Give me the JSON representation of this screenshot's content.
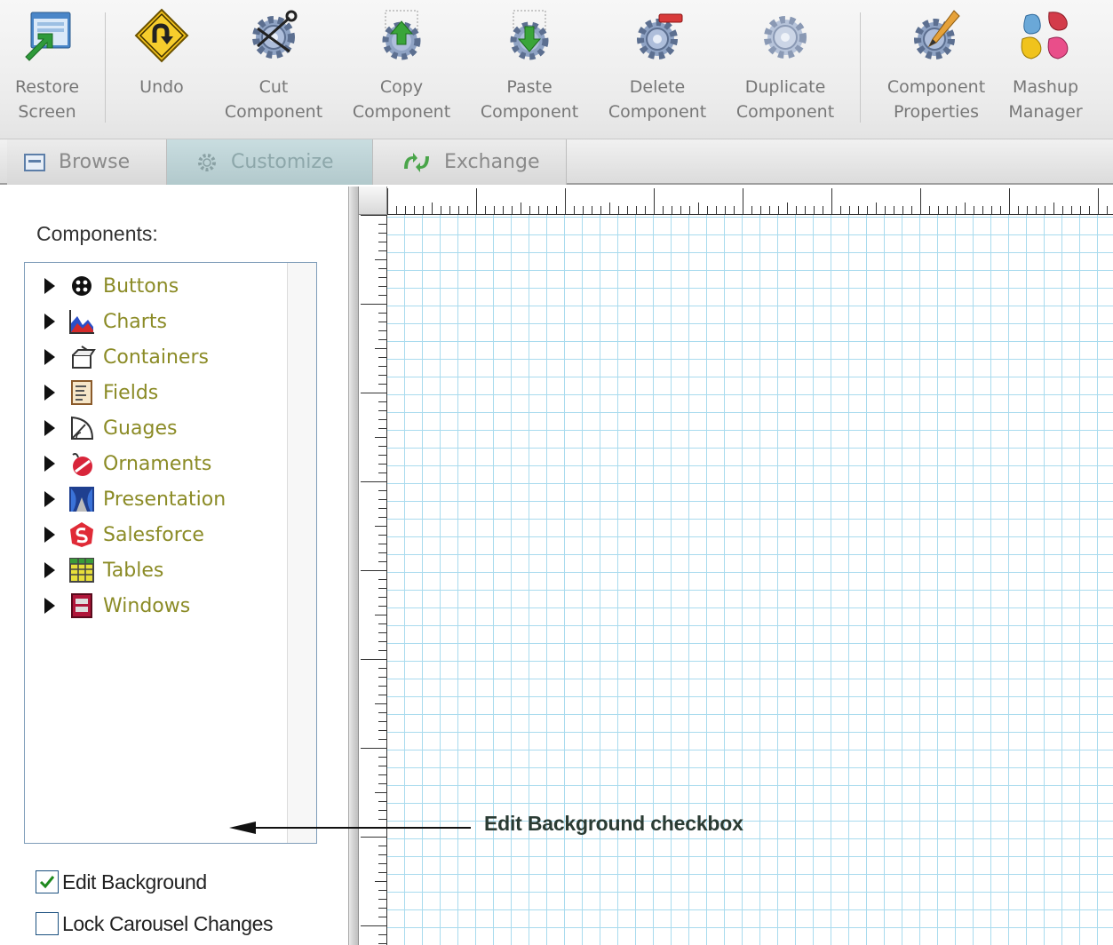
{
  "toolbar": {
    "restore_screen": "Restore\nScreen",
    "undo": "Undo",
    "cut_component": "Cut\nComponent",
    "copy_component": "Copy\nComponent",
    "paste_component": "Paste\nComponent",
    "delete_component": "Delete\nComponent",
    "duplicate_component": "Duplicate\nComponent",
    "component_properties": "Component\nProperties",
    "mashup_manager": "Mashup\nManager"
  },
  "tabs": [
    {
      "label": "Browse",
      "icon": "window-icon",
      "active": false
    },
    {
      "label": "Customize",
      "icon": "gear-icon",
      "active": true
    },
    {
      "label": "Exchange",
      "icon": "exchange-icon",
      "active": false
    }
  ],
  "panel": {
    "components_label": "Components:",
    "tree": [
      {
        "label": "Buttons",
        "icon": "buttons-icon"
      },
      {
        "label": "Charts",
        "icon": "charts-icon"
      },
      {
        "label": "Containers",
        "icon": "containers-icon"
      },
      {
        "label": "Fields",
        "icon": "fields-icon"
      },
      {
        "label": "Guages",
        "icon": "gauges-icon"
      },
      {
        "label": "Ornaments",
        "icon": "ornaments-icon"
      },
      {
        "label": "Presentation",
        "icon": "presentation-icon"
      },
      {
        "label": "Salesforce",
        "icon": "salesforce-icon"
      },
      {
        "label": "Tables",
        "icon": "tables-icon"
      },
      {
        "label": "Windows",
        "icon": "windows-icon"
      }
    ],
    "edit_background": {
      "label": "Edit Background",
      "checked": true
    },
    "lock_carousel": {
      "label": "Lock Carousel Changes",
      "checked": false
    }
  },
  "annotation": {
    "text": "Edit Background checkbox"
  },
  "colors": {
    "tree_label": "#8b8b26",
    "grid_line": "#a9dbee",
    "active_tab": "#c9dde0"
  }
}
